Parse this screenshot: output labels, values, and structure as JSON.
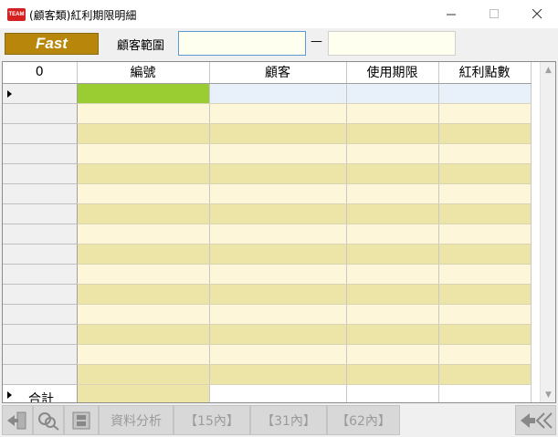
{
  "window": {
    "title": "(顧客類)紅利期限明細",
    "app_icon_label": "TEAM"
  },
  "toolbar": {
    "fast_label": "Fast",
    "range_label": "顧客範圍",
    "range_from_value": "",
    "range_dash": "—",
    "range_to_value": ""
  },
  "grid": {
    "corner_label": "0",
    "columns": [
      "編號",
      "顧客",
      "使用期限",
      "紅利點數"
    ],
    "row_count": 15,
    "total_label": "合計"
  },
  "bottom": {
    "analysis_label": "資料分析",
    "within15_label": "【15內】",
    "within31_label": "【31內】",
    "within62_label": "【62內】"
  },
  "colors": {
    "fast_button": "#b8860b",
    "selected_cell": "#9acd32",
    "row_light": "#fdf6d8",
    "row_dark": "#ede5a8"
  }
}
